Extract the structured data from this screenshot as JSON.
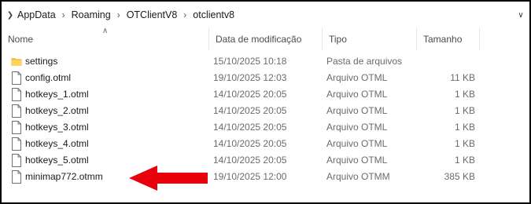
{
  "breadcrumb": {
    "items": [
      "AppData",
      "Roaming",
      "OTClientV8",
      "otclientv8"
    ]
  },
  "columns": {
    "name": "Nome",
    "date": "Data de modificação",
    "type": "Tipo",
    "size": "Tamanho"
  },
  "files": [
    {
      "name": "settings",
      "date": "15/10/2025 10:18",
      "type": "Pasta de arquivos",
      "size": "",
      "icon": "folder-icon"
    },
    {
      "name": "config.otml",
      "date": "19/10/2025 12:03",
      "type": "Arquivo OTML",
      "size": "11 KB",
      "icon": "file-icon"
    },
    {
      "name": "hotkeys_1.otml",
      "date": "14/10/2025 20:05",
      "type": "Arquivo OTML",
      "size": "1 KB",
      "icon": "file-icon"
    },
    {
      "name": "hotkeys_2.otml",
      "date": "14/10/2025 20:05",
      "type": "Arquivo OTML",
      "size": "1 KB",
      "icon": "file-icon"
    },
    {
      "name": "hotkeys_3.otml",
      "date": "14/10/2025 20:05",
      "type": "Arquivo OTML",
      "size": "1 KB",
      "icon": "file-icon"
    },
    {
      "name": "hotkeys_4.otml",
      "date": "14/10/2025 20:05",
      "type": "Arquivo OTML",
      "size": "1 KB",
      "icon": "file-icon"
    },
    {
      "name": "hotkeys_5.otml",
      "date": "14/10/2025 20:05",
      "type": "Arquivo OTML",
      "size": "1 KB",
      "icon": "file-icon"
    },
    {
      "name": "minimap772.otmm",
      "date": "19/10/2025 12:00",
      "type": "Arquivo OTMM",
      "size": "385 KB",
      "icon": "file-icon"
    }
  ],
  "annotation": {
    "arrow_color": "#e8000b",
    "points_to": "minimap772.otmm"
  }
}
